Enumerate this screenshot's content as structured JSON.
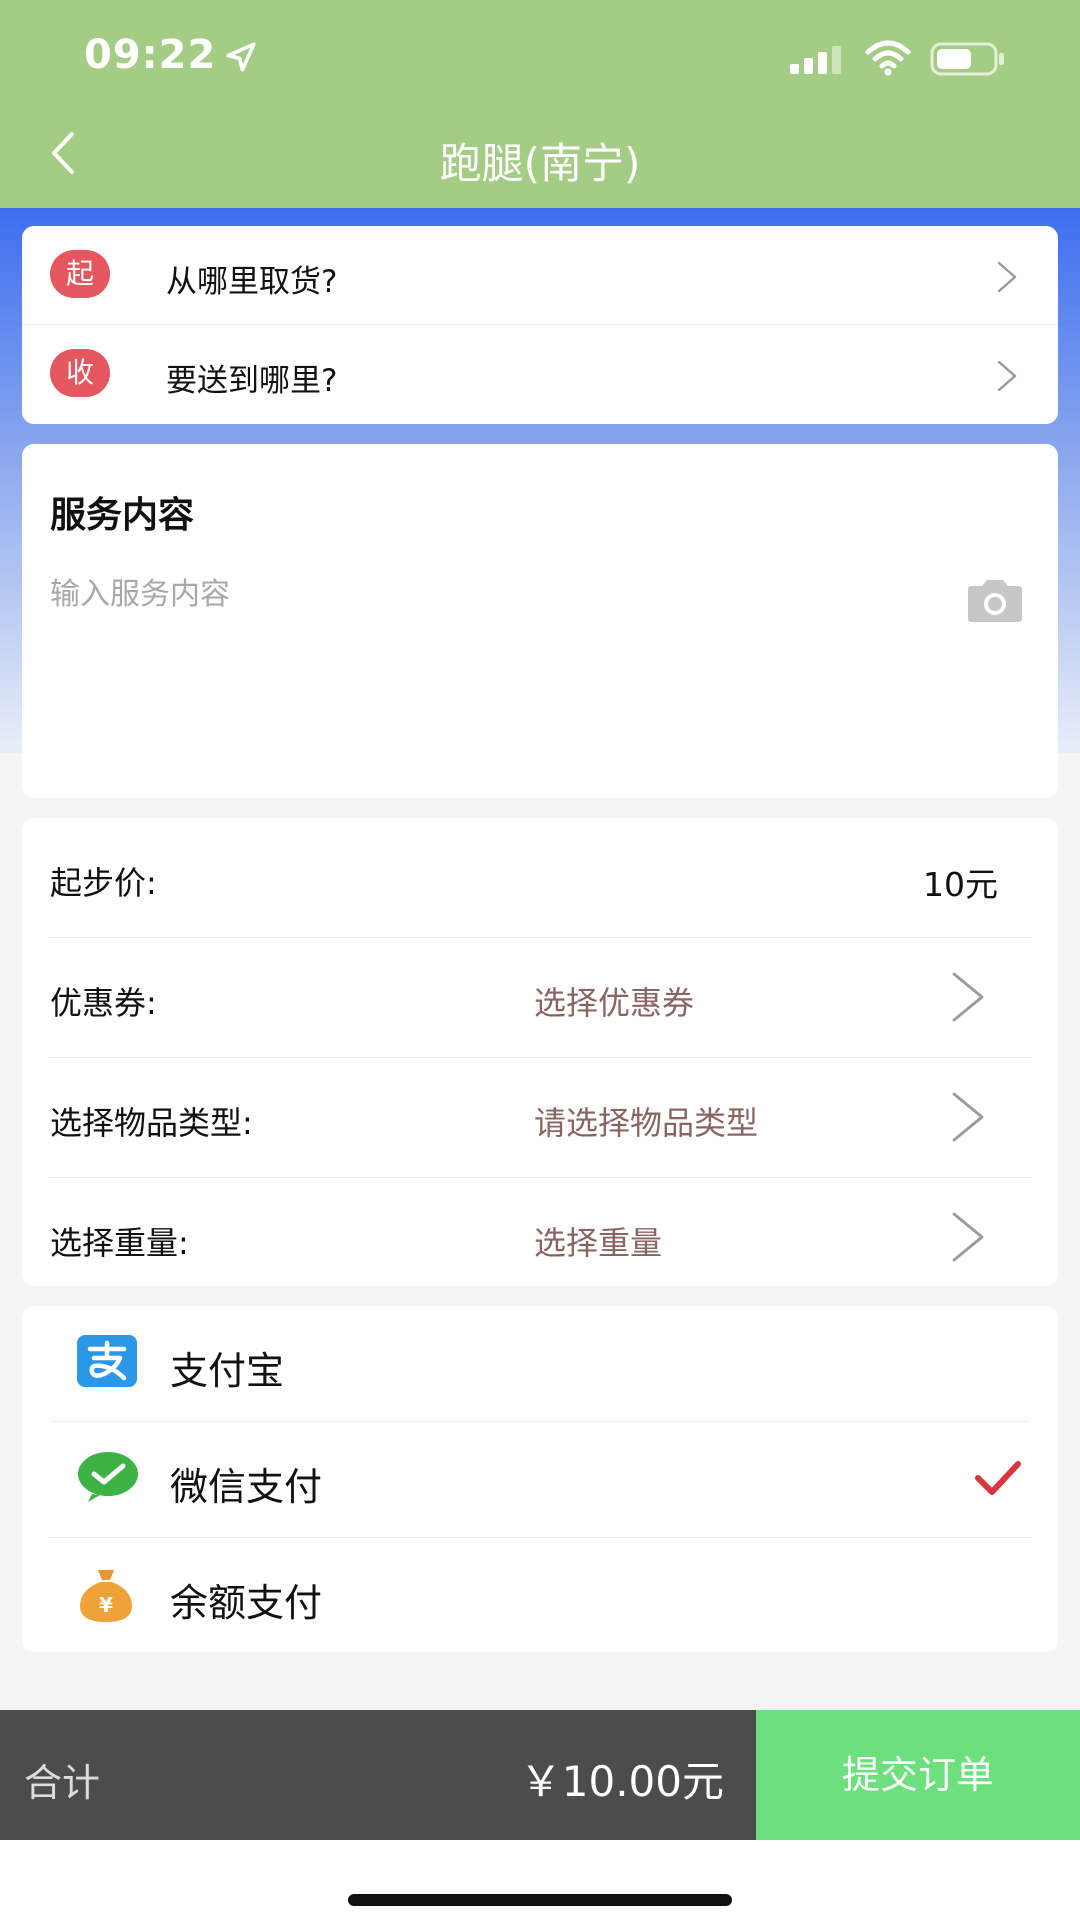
{
  "status_bar": {
    "time": "09:22"
  },
  "nav": {
    "title": "跑腿(南宁)"
  },
  "address": {
    "pickup_badge": "起",
    "pickup_placeholder": "从哪里取货?",
    "delivery_badge": "收",
    "delivery_placeholder": "要送到哪里?"
  },
  "service": {
    "title": "服务内容",
    "placeholder": "输入服务内容"
  },
  "pricing": {
    "base_price_label": "起步价:",
    "base_price_value": "10元",
    "coupon_label": "优惠券:",
    "coupon_select": "选择优惠券",
    "item_type_label": "选择物品类型:",
    "item_type_select": "请选择物品类型",
    "weight_label": "选择重量:",
    "weight_select": "选择重量"
  },
  "payment": {
    "methods": [
      {
        "label": "支付宝",
        "icon": "alipay-icon",
        "selected": false
      },
      {
        "label": "微信支付",
        "icon": "wechat-pay-icon",
        "selected": true
      },
      {
        "label": "余额支付",
        "icon": "balance-bag-icon",
        "selected": false
      }
    ]
  },
  "footer": {
    "total_label": "合计",
    "total_value": "￥10.00元",
    "submit_label": "提交订单"
  },
  "colors": {
    "header_green": "#a4cc84",
    "submit_green": "#6ddf7d",
    "badge_red": "#e4575f",
    "select_text": "#8a6560",
    "check_red": "#d9363e"
  }
}
